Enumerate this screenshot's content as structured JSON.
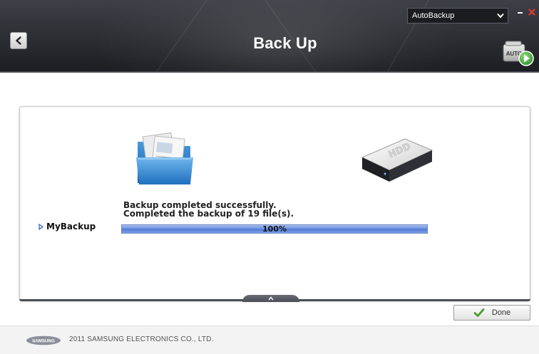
{
  "header": {
    "title": "Back Up",
    "back_icon": "back-arrow-icon",
    "mode_select": {
      "value": "AutoBackup"
    },
    "auto_backup_icon_label": "AUTO"
  },
  "main": {
    "source_icon": "folder-icon",
    "target_icon": "hdd-icon",
    "hdd_label": "HDD",
    "status_line_1": "Backup completed successfully.",
    "status_line_2": "Completed the backup of 19 file(s).",
    "job_name": "MyBackup",
    "progress": {
      "percent": 100,
      "label": "100%"
    }
  },
  "actions": {
    "done_label": "Done"
  },
  "footer": {
    "logo_text": "SAMSUNG",
    "copyright": "2011 SAMSUNG ELECTRONICS CO., LTD."
  },
  "colors": {
    "header_bg": "#2b2d33",
    "progress_fill": "#5b82dc",
    "close_red": "#e23a2c",
    "done_check_green": "#4a9a2c",
    "auto_play_green": "#3ea83a"
  }
}
